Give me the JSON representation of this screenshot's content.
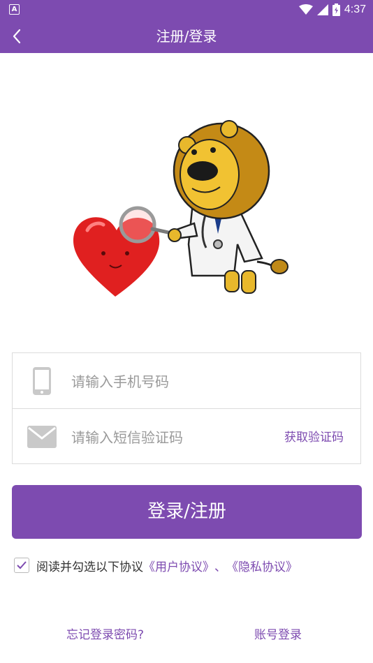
{
  "status_bar": {
    "notification_icon_label": "A",
    "time": "4:37"
  },
  "header": {
    "title": "注册/登录"
  },
  "form": {
    "phone_placeholder": "请输入手机号码",
    "sms_placeholder": "请输入短信验证码",
    "get_code_label": "获取验证码"
  },
  "login_button": {
    "label": "登录/注册"
  },
  "agreement": {
    "checked": true,
    "text": "阅读并勾选以下协议",
    "user_agreement": "《用户协议》",
    "separator": "、",
    "privacy_policy": "《隐私协议》"
  },
  "footer": {
    "forgot_password": "忘记登录密码?",
    "account_login": "账号登录"
  },
  "colors": {
    "primary": "#7d4bb0",
    "border": "#dcdcdc",
    "placeholder": "#9a9a9a"
  },
  "icons": {
    "back": "chevron-left-icon",
    "phone": "phone-icon",
    "mail": "mail-icon",
    "check": "check-icon",
    "wifi": "wifi-icon",
    "signal": "signal-icon",
    "battery": "battery-icon"
  }
}
